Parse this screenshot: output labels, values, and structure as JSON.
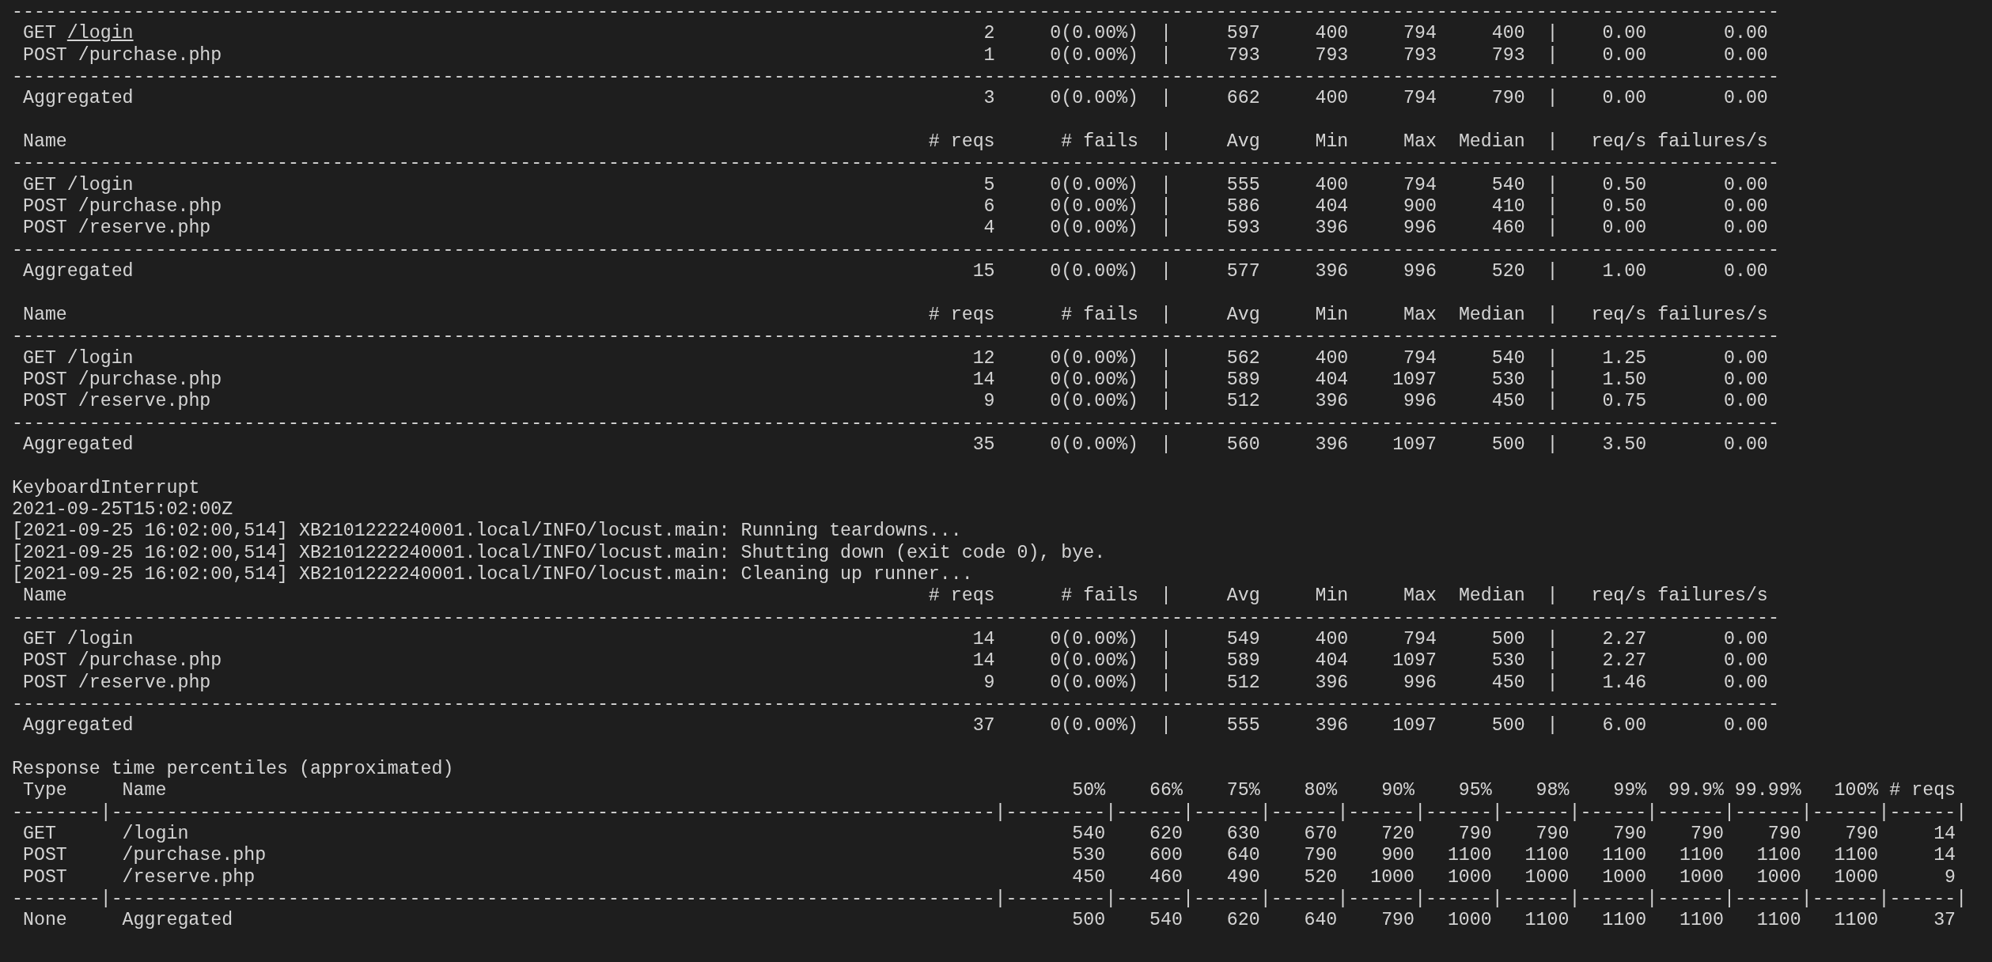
{
  "lines": [
    {
      "kind": "rule",
      "text": "----------------------------------------------------------------------------------------------------------------------------------------------------------------"
    },
    {
      "kind": "row",
      "name_parts": [
        {
          "text": "GET",
          "underlined": false
        },
        {
          "text": "/login",
          "underlined": true
        }
      ],
      "cells": [
        "2",
        "0(0.00%)",
        "|",
        "597",
        "400",
        "794",
        "400",
        "|",
        "0.00",
        "0.00"
      ]
    },
    {
      "kind": "row",
      "name": "POST /purchase.php",
      "cells": [
        "1",
        "0(0.00%)",
        "|",
        "793",
        "793",
        "793",
        "793",
        "|",
        "0.00",
        "0.00"
      ]
    },
    {
      "kind": "rule",
      "text": "----------------------------------------------------------------------------------------------------------------------------------------------------------------"
    },
    {
      "kind": "row",
      "name": "Aggregated",
      "cells": [
        "3",
        "0(0.00%)",
        "|",
        "662",
        "400",
        "794",
        "790",
        "|",
        "0.00",
        "0.00"
      ]
    },
    {
      "kind": "blank"
    },
    {
      "kind": "header",
      "name": "Name",
      "cells": [
        "# reqs",
        "# fails",
        "|",
        "Avg",
        "Min",
        "Max",
        "Median",
        "|",
        "req/s",
        "failures/s"
      ]
    },
    {
      "kind": "rule",
      "text": "----------------------------------------------------------------------------------------------------------------------------------------------------------------"
    },
    {
      "kind": "row",
      "name": "GET /login",
      "cells": [
        "5",
        "0(0.00%)",
        "|",
        "555",
        "400",
        "794",
        "540",
        "|",
        "0.50",
        "0.00"
      ]
    },
    {
      "kind": "row",
      "name": "POST /purchase.php",
      "cells": [
        "6",
        "0(0.00%)",
        "|",
        "586",
        "404",
        "900",
        "410",
        "|",
        "0.50",
        "0.00"
      ]
    },
    {
      "kind": "row",
      "name": "POST /reserve.php",
      "cells": [
        "4",
        "0(0.00%)",
        "|",
        "593",
        "396",
        "996",
        "460",
        "|",
        "0.00",
        "0.00"
      ]
    },
    {
      "kind": "rule",
      "text": "----------------------------------------------------------------------------------------------------------------------------------------------------------------"
    },
    {
      "kind": "row",
      "name": "Aggregated",
      "cells": [
        "15",
        "0(0.00%)",
        "|",
        "577",
        "396",
        "996",
        "520",
        "|",
        "1.00",
        "0.00"
      ]
    },
    {
      "kind": "blank"
    },
    {
      "kind": "header",
      "name": "Name",
      "cells": [
        "# reqs",
        "# fails",
        "|",
        "Avg",
        "Min",
        "Max",
        "Median",
        "|",
        "req/s",
        "failures/s"
      ]
    },
    {
      "kind": "rule",
      "text": "----------------------------------------------------------------------------------------------------------------------------------------------------------------"
    },
    {
      "kind": "row",
      "name": "GET /login",
      "cells": [
        "12",
        "0(0.00%)",
        "|",
        "562",
        "400",
        "794",
        "540",
        "|",
        "1.25",
        "0.00"
      ]
    },
    {
      "kind": "row",
      "name": "POST /purchase.php",
      "cells": [
        "14",
        "0(0.00%)",
        "|",
        "589",
        "404",
        "1097",
        "530",
        "|",
        "1.50",
        "0.00"
      ]
    },
    {
      "kind": "row",
      "name": "POST /reserve.php",
      "cells": [
        "9",
        "0(0.00%)",
        "|",
        "512",
        "396",
        "996",
        "450",
        "|",
        "0.75",
        "0.00"
      ]
    },
    {
      "kind": "rule",
      "text": "----------------------------------------------------------------------------------------------------------------------------------------------------------------"
    },
    {
      "kind": "row",
      "name": "Aggregated",
      "cells": [
        "35",
        "0(0.00%)",
        "|",
        "560",
        "396",
        "1097",
        "500",
        "|",
        "3.50",
        "0.00"
      ]
    },
    {
      "kind": "blank"
    },
    {
      "kind": "text",
      "text": "KeyboardInterrupt"
    },
    {
      "kind": "text",
      "text": "2021-09-25T15:02:00Z"
    },
    {
      "kind": "text",
      "text": "[2021-09-25 16:02:00,514] XB2101222240001.local/INFO/locust.main: Running teardowns..."
    },
    {
      "kind": "text",
      "text": "[2021-09-25 16:02:00,514] XB2101222240001.local/INFO/locust.main: Shutting down (exit code 0), bye."
    },
    {
      "kind": "text",
      "text": "[2021-09-25 16:02:00,514] XB2101222240001.local/INFO/locust.main: Cleaning up runner..."
    },
    {
      "kind": "header",
      "name": "Name",
      "cells": [
        "# reqs",
        "# fails",
        "|",
        "Avg",
        "Min",
        "Max",
        "Median",
        "|",
        "req/s",
        "failures/s"
      ]
    },
    {
      "kind": "rule",
      "text": "----------------------------------------------------------------------------------------------------------------------------------------------------------------"
    },
    {
      "kind": "row",
      "name": "GET /login",
      "cells": [
        "14",
        "0(0.00%)",
        "|",
        "549",
        "400",
        "794",
        "500",
        "|",
        "2.27",
        "0.00"
      ]
    },
    {
      "kind": "row",
      "name": "POST /purchase.php",
      "cells": [
        "14",
        "0(0.00%)",
        "|",
        "589",
        "404",
        "1097",
        "530",
        "|",
        "2.27",
        "0.00"
      ]
    },
    {
      "kind": "row",
      "name": "POST /reserve.php",
      "cells": [
        "9",
        "0(0.00%)",
        "|",
        "512",
        "396",
        "996",
        "450",
        "|",
        "1.46",
        "0.00"
      ]
    },
    {
      "kind": "rule",
      "text": "----------------------------------------------------------------------------------------------------------------------------------------------------------------"
    },
    {
      "kind": "row",
      "name": "Aggregated",
      "cells": [
        "37",
        "0(0.00%)",
        "|",
        "555",
        "396",
        "1097",
        "500",
        "|",
        "6.00",
        "0.00"
      ]
    },
    {
      "kind": "blank"
    },
    {
      "kind": "text",
      "text": "Response time percentiles (approximated)"
    },
    {
      "kind": "pheader",
      "cells": [
        "Type",
        "Name",
        "50%",
        "66%",
        "75%",
        "80%",
        "90%",
        "95%",
        "98%",
        "99%",
        "99.9%",
        "99.99%",
        "100%",
        "# reqs"
      ]
    },
    {
      "kind": "prule",
      "text": "--------|--------------------------------------------------------------------------------|---------|------|------|------|------|------|------|------|------|------|------|------|"
    },
    {
      "kind": "prow",
      "cells": [
        "GET",
        "/login",
        "540",
        "620",
        "630",
        "670",
        "720",
        "790",
        "790",
        "790",
        "790",
        "790",
        "790",
        "14"
      ]
    },
    {
      "kind": "prow",
      "cells": [
        "POST",
        "/purchase.php",
        "530",
        "600",
        "640",
        "790",
        "900",
        "1100",
        "1100",
        "1100",
        "1100",
        "1100",
        "1100",
        "14"
      ]
    },
    {
      "kind": "prow",
      "cells": [
        "POST",
        "/reserve.php",
        "450",
        "460",
        "490",
        "520",
        "1000",
        "1000",
        "1000",
        "1000",
        "1000",
        "1000",
        "1000",
        "9"
      ]
    },
    {
      "kind": "prule",
      "text": "--------|--------------------------------------------------------------------------------|---------|------|------|------|------|------|------|------|------|------|------|------|"
    },
    {
      "kind": "prow",
      "cells": [
        "None",
        "Aggregated",
        "500",
        "540",
        "620",
        "640",
        "790",
        "1000",
        "1100",
        "1100",
        "1100",
        "1100",
        "1100",
        "37"
      ]
    }
  ]
}
